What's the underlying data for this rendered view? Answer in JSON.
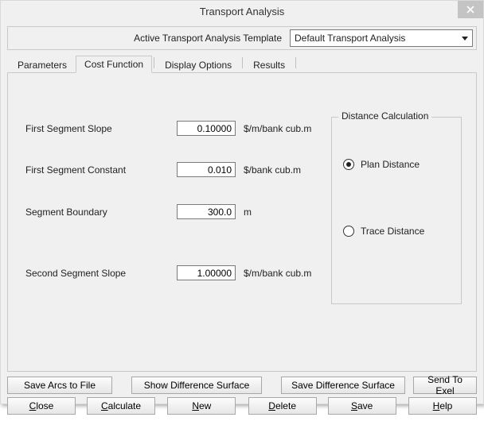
{
  "window": {
    "title": "Transport Analysis"
  },
  "template": {
    "label": "Active Transport Analysis Template",
    "selected": "Default Transport Analysis"
  },
  "tabs": {
    "parameters": "Parameters",
    "cost_function": "Cost Function",
    "display_options": "Display Options",
    "results": "Results",
    "active": "cost_function"
  },
  "fields": {
    "first_slope": {
      "label": "First Segment Slope",
      "value": "0.10000",
      "unit": "$/m/bank cub.m"
    },
    "first_const": {
      "label": "First Segment Constant",
      "value": "0.010",
      "unit": "$/bank cub.m"
    },
    "seg_boundary": {
      "label": "Segment Boundary",
      "value": "300.0",
      "unit": "m"
    },
    "second_slope": {
      "label": "Second Segment Slope",
      "value": "1.00000",
      "unit": "$/m/bank cub.m"
    }
  },
  "group": {
    "title": "Distance Calculation",
    "plan": "Plan Distance",
    "trace": "Trace Distance",
    "selected": "plan"
  },
  "buttons": {
    "row1": {
      "save_arcs": "Save Arcs to File",
      "show_diff": "Show Difference Surface",
      "save_diff": "Save Difference Surface",
      "send_exel": "Send To Exel"
    },
    "row2": {
      "close": "Close",
      "calculate": "Calculate",
      "new": "New",
      "delete": "Delete",
      "save": "Save",
      "help": "Help"
    }
  }
}
